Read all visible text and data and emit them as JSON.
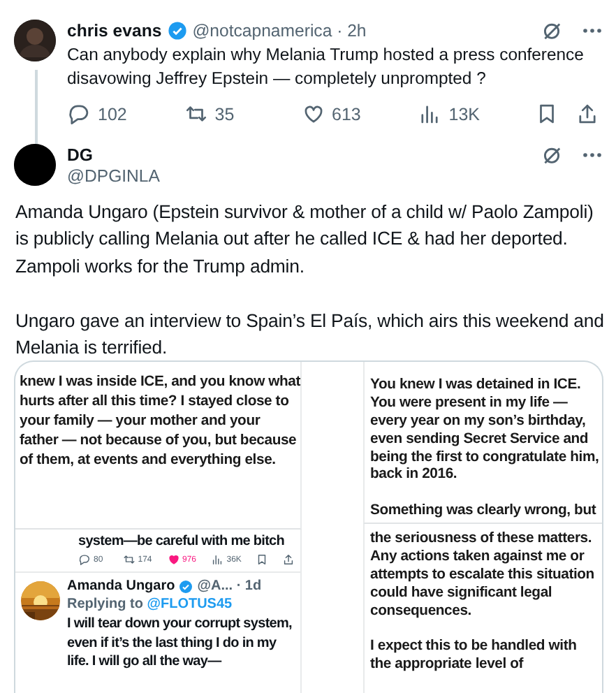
{
  "tweets": [
    {
      "name": "chris evans",
      "verified": true,
      "meta": "@notcapnamerica · 2h",
      "thread_line": true,
      "paragraphs": [
        "Can anybody explain why Melania Trump hosted a press conference disavowing Jeffrey Epstein — completely unprompted ?"
      ],
      "stats": [
        {
          "kind": "reply",
          "count": "102"
        },
        {
          "kind": "repost",
          "count": "35"
        },
        {
          "kind": "like",
          "count": "613"
        },
        {
          "kind": "views",
          "count": "13K"
        },
        {
          "kind": "bookmark"
        },
        {
          "kind": "share"
        }
      ]
    },
    {
      "name": "DG",
      "verified": false,
      "meta": "@DPGINLA",
      "thread_line": false,
      "paragraphs": [
        "Amanda Ungaro (Epstein survivor & mother of a child w/ Paolo Zampoli) is publicly calling Melania out after he called ICE & had her deported. Zampoli works for the Trump admin.",
        "Ungaro gave an interview to Spain’s El País, which airs this weekend and Melania is terrified."
      ],
      "media": {
        "left_top": [
          "knew I was inside ICE, and you know what hurts after all this time? I stayed close to your family — your mother and your father — not because of you, but because of them, at events and everything else."
        ],
        "left_bottom": {
          "text": "system—be careful with me bitch",
          "stats": [
            {
              "kind": "reply",
              "count": "80"
            },
            {
              "kind": "repost",
              "count": "174"
            },
            {
              "kind": "like",
              "count": "976",
              "liked": true
            },
            {
              "kind": "views",
              "count": "36K"
            },
            {
              "kind": "bookmark"
            },
            {
              "kind": "share"
            }
          ],
          "reply": {
            "name": "Amanda Ungaro",
            "verified": true,
            "meta": "@A... · 1d",
            "replying_to": "Replying to",
            "mention": "@FLOTUS45",
            "text": "I will tear down your corrupt system, even if it’s the last thing I do in my life. I will go all the way—"
          }
        },
        "right_top": [
          "You knew I was detained in ICE. You were present in my life — every year on my son’s birthday, even sending Secret Service and being the first to congratulate him, back in 2016.",
          "Something was clearly wrong, but"
        ],
        "right_bottom": [
          "the seriousness of these matters. Any actions taken against me or attempts to escalate this situation could have significant legal consequences.",
          "I expect this to be handled with the appropriate level of"
        ]
      }
    }
  ]
}
